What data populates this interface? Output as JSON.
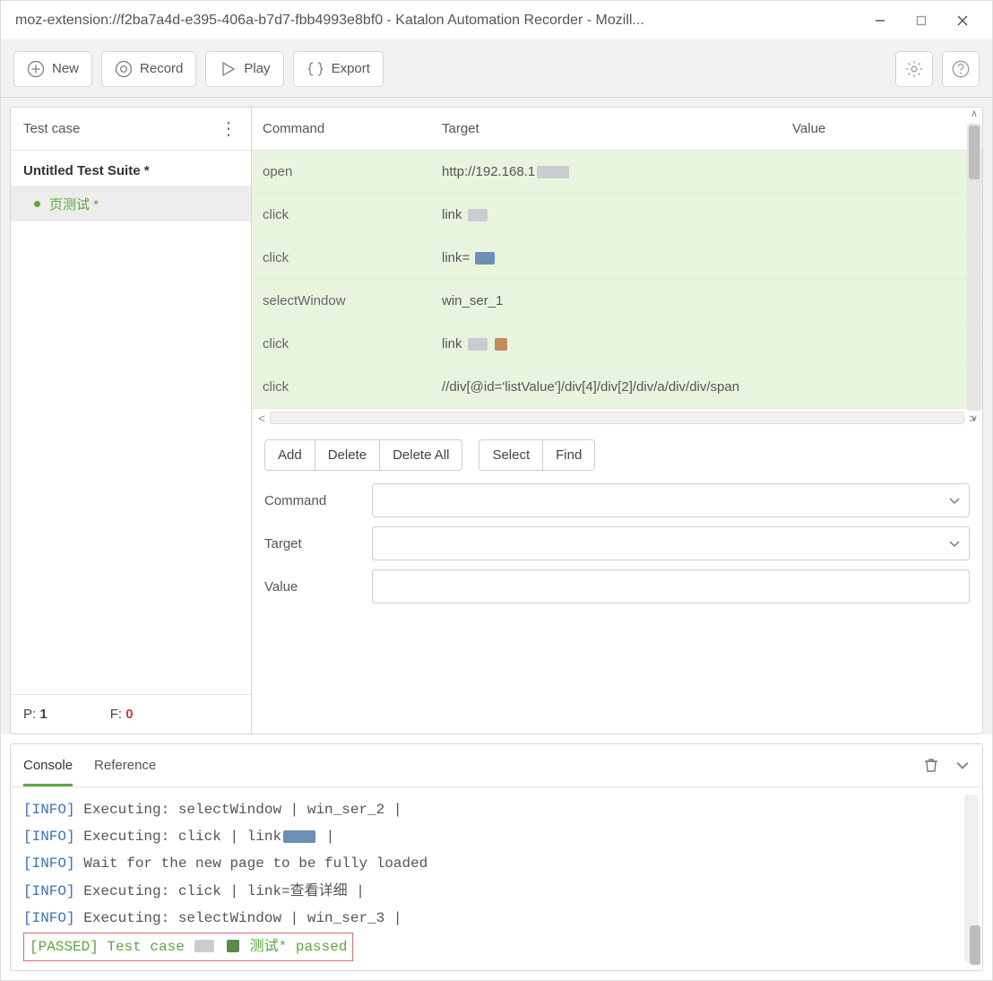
{
  "title": "moz-extension://f2ba7a4d-e395-406a-b7d7-fbb4993e8bf0 - Katalon Automation Recorder - Mozill...",
  "toolbar": {
    "new_label": "New",
    "record_label": "Record",
    "play_label": "Play",
    "export_label": "Export"
  },
  "sidebar": {
    "header": "Test case",
    "suite_name": "Untitled Test Suite *",
    "test_case_name": "页测试 *",
    "pass_label": "P:",
    "pass_count": "1",
    "fail_label": "F:",
    "fail_count": "0"
  },
  "commands": {
    "headers": {
      "command": "Command",
      "target": "Target",
      "value": "Value"
    },
    "rows": [
      {
        "command": "open",
        "target": "http://192.168.1",
        "value": ""
      },
      {
        "command": "click",
        "target": "link",
        "value": ""
      },
      {
        "command": "click",
        "target": "link=",
        "value": ""
      },
      {
        "command": "selectWindow",
        "target": "win_ser_1",
        "value": ""
      },
      {
        "command": "click",
        "target": "link",
        "value": ""
      },
      {
        "command": "click",
        "target": "//div[@id='listValue']/div[4]/div[2]/div/a/div/div/span",
        "value": ""
      }
    ]
  },
  "actions": {
    "add": "Add",
    "delete": "Delete",
    "delete_all": "Delete All",
    "select": "Select",
    "find": "Find"
  },
  "form": {
    "command_label": "Command",
    "target_label": "Target",
    "value_label": "Value"
  },
  "bottom": {
    "tab_console": "Console",
    "tab_reference": "Reference",
    "log": [
      {
        "tag": "[INFO]",
        "text": "Executing: selectWindow | win_ser_2 |"
      },
      {
        "tag": "[INFO]",
        "text": "Executing: click | link"
      },
      {
        "tag": "[INFO]",
        "text": "Wait for the new page to be fully loaded"
      },
      {
        "tag": "[INFO]",
        "text": "Executing: click | link=查看详细 |"
      },
      {
        "tag": "[INFO]",
        "text": "Executing: selectWindow | win_ser_3 |"
      }
    ],
    "passed_tag": "[PASSED]",
    "passed_text_pre": "Test case ",
    "passed_text_post": "测试* passed"
  }
}
